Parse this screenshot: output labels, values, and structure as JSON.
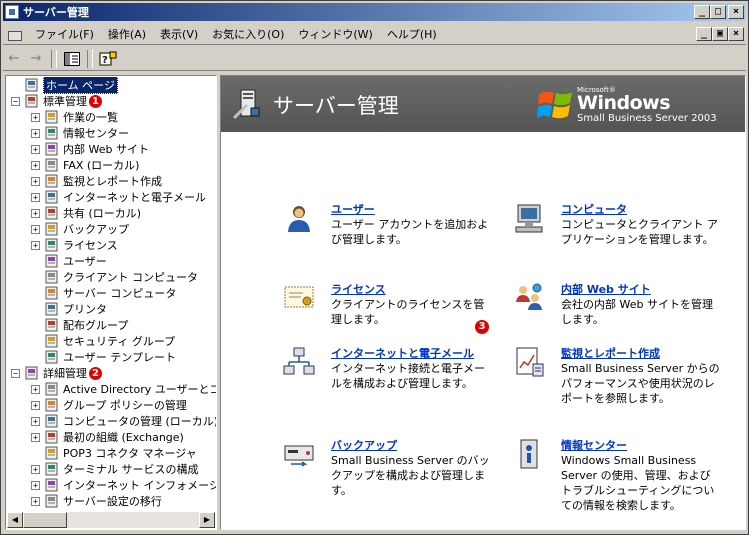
{
  "window": {
    "title": "サーバー管理"
  },
  "title_buttons": {
    "minimize": "_",
    "maximize": "□",
    "close": "×"
  },
  "mdi_buttons": {
    "minimize": "_",
    "restore": "▣",
    "close": "×"
  },
  "menu": [
    "ファイル(F)",
    "操作(A)",
    "表示(V)",
    "お気に入り(O)",
    "ウィンドウ(W)",
    "ヘルプ(H)"
  ],
  "toolbar": {
    "back": "←",
    "forward": "→",
    "show_hide": "▥",
    "help": "?"
  },
  "tree": [
    {
      "label": "ホーム ページ",
      "level": 0,
      "expander": "none",
      "selected": true,
      "icon": "home-icon"
    },
    {
      "label": "標準管理",
      "level": 0,
      "expander": "minus",
      "badge": "1",
      "icon": "server-icon"
    },
    {
      "label": "作業の一覧",
      "level": 1,
      "expander": "plus",
      "icon": "tasks-icon"
    },
    {
      "label": "情報センター",
      "level": 1,
      "expander": "plus",
      "icon": "info-icon"
    },
    {
      "label": "内部 Web サイト",
      "level": 1,
      "expander": "plus",
      "icon": "web-icon"
    },
    {
      "label": "FAX (ローカル)",
      "level": 1,
      "expander": "plus",
      "icon": "fax-icon"
    },
    {
      "label": "監視とレポート作成",
      "level": 1,
      "expander": "plus",
      "icon": "report-icon"
    },
    {
      "label": "インターネットと電子メール",
      "level": 1,
      "expander": "plus",
      "icon": "internet-icon"
    },
    {
      "label": "共有 (ローカル)",
      "level": 1,
      "expander": "plus",
      "icon": "folder-icon"
    },
    {
      "label": "バックアップ",
      "level": 1,
      "expander": "plus",
      "icon": "backup-icon"
    },
    {
      "label": "ライセンス",
      "level": 1,
      "expander": "plus",
      "icon": "license-icon"
    },
    {
      "label": "ユーザー",
      "level": 1,
      "expander": "none",
      "icon": "user-icon"
    },
    {
      "label": "クライアント コンピュータ",
      "level": 1,
      "expander": "none",
      "icon": "computer-icon"
    },
    {
      "label": "サーバー コンピュータ",
      "level": 1,
      "expander": "none",
      "icon": "server-computer-icon"
    },
    {
      "label": "プリンタ",
      "level": 1,
      "expander": "none",
      "icon": "printer-icon"
    },
    {
      "label": "配布グループ",
      "level": 1,
      "expander": "none",
      "icon": "group-icon"
    },
    {
      "label": "セキュリティ グループ",
      "level": 1,
      "expander": "none",
      "icon": "security-group-icon"
    },
    {
      "label": "ユーザー テンプレート",
      "level": 1,
      "expander": "none",
      "icon": "template-icon"
    },
    {
      "label": "詳細管理",
      "level": 0,
      "expander": "minus",
      "badge": "2",
      "icon": "advanced-icon"
    },
    {
      "label": "Active Directory ユーザーとコン",
      "level": 1,
      "expander": "plus",
      "icon": "ad-icon"
    },
    {
      "label": "グループ ポリシーの管理",
      "level": 1,
      "expander": "plus",
      "icon": "policy-icon"
    },
    {
      "label": "コンピュータの管理 (ローカル)",
      "level": 1,
      "expander": "plus",
      "icon": "computer-mgmt-icon"
    },
    {
      "label": "最初の組織 (Exchange)",
      "level": 1,
      "expander": "plus",
      "icon": "exchange-icon"
    },
    {
      "label": "POP3 コネクタ マネージャ",
      "level": 1,
      "expander": "none",
      "icon": "pop3-icon"
    },
    {
      "label": "ターミナル サービスの構成",
      "level": 1,
      "expander": "plus",
      "icon": "terminal-icon"
    },
    {
      "label": "インターネット インフォメーション サ",
      "level": 1,
      "expander": "plus",
      "icon": "iis-icon"
    },
    {
      "label": "サーバー設定の移行",
      "level": 1,
      "expander": "plus",
      "icon": "migrate-icon"
    }
  ],
  "hscroll": {
    "left": "◀",
    "right": "▶"
  },
  "banner": {
    "title": "サーバー管理",
    "logo_ms": "Microsoft®",
    "logo_windows": "Windows",
    "logo_product": "Small Business Server 2003"
  },
  "main_badge": "3",
  "items": [
    {
      "title": "ユーザー",
      "desc": "ユーザー アカウントを追加および管理します。",
      "icon": "user-icon"
    },
    {
      "title": "コンピュータ",
      "desc": "コンピュータとクライアント アプリケーションを管理します。",
      "icon": "computer-icon"
    },
    {
      "title": "ライセンス",
      "desc": "クライアントのライセンスを管理します。",
      "icon": "license-icon"
    },
    {
      "title": "内部 Web サイト",
      "desc": "会社の内部 Web サイトを管理します。",
      "icon": "web-icon"
    },
    {
      "title": "インターネットと電子メール",
      "desc": "インターネット接続と電子メールを構成および管理します。",
      "icon": "internet-icon"
    },
    {
      "title": "監視とレポート作成",
      "desc": "Small Business Server からのパフォーマンスや使用状況のレポートを参照します。",
      "icon": "report-icon"
    },
    {
      "title": "バックアップ",
      "desc": "Small Business Server のバックアップを構成および管理します。",
      "icon": "backup-icon"
    },
    {
      "title": "情報センター",
      "desc": "Windows Small Business Server の使用、管理、およびトラブルシューティングについての情報を検索します。",
      "icon": "info-icon"
    }
  ]
}
